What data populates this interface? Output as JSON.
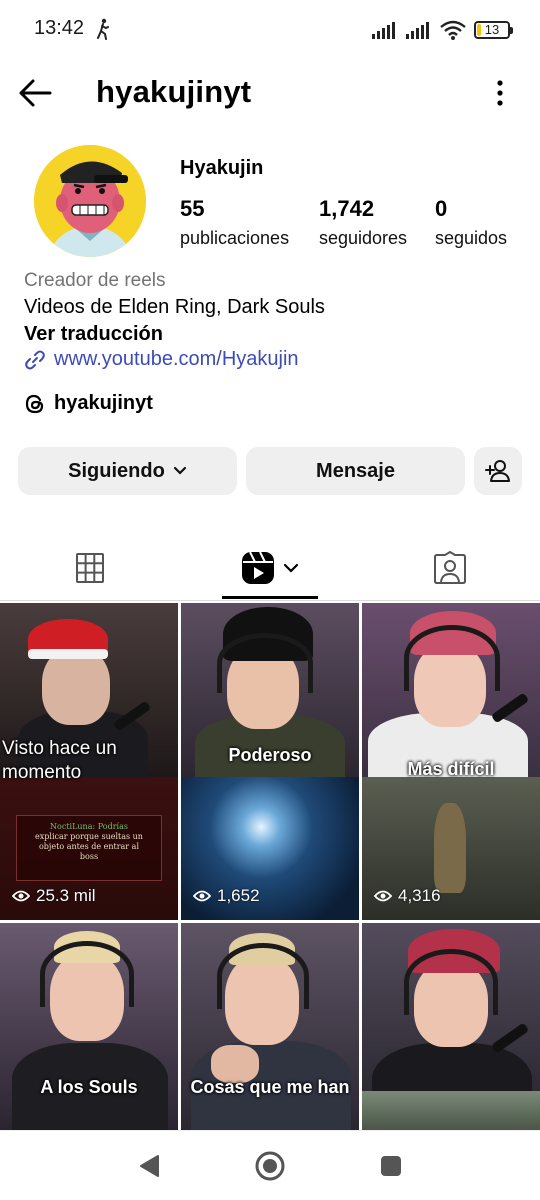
{
  "status_bar": {
    "time": "13:42",
    "battery": "13"
  },
  "header": {
    "username": "hyakujinyt"
  },
  "profile": {
    "display_name": "Hyakujin",
    "stats": [
      {
        "value": "55",
        "label": "publicaciones"
      },
      {
        "value": "1,742",
        "label": "seguidores"
      },
      {
        "value": "0",
        "label": "seguidos"
      }
    ],
    "category": "Creador de reels",
    "bio": "Videos de Elden Ring, Dark Souls",
    "translate": "Ver traducción",
    "link": "www.youtube.com/Hyakujin",
    "threads": "hyakujinyt"
  },
  "actions": {
    "following": "Siguiendo",
    "message": "Mensaje"
  },
  "tabs": {
    "active": "reels"
  },
  "reels": [
    {
      "caption": "Visto hace un momento",
      "views": "25.3 mil",
      "overlay_line1": "NoctiLuna: Podrías",
      "overlay_line2": "explicar porque sueltas un",
      "overlay_line3": "objeto antes de entrar al",
      "overlay_line4": "boss"
    },
    {
      "caption": "Poderoso",
      "views": "1,652"
    },
    {
      "caption": "Más difícil",
      "views": "4,316"
    },
    {
      "caption": "A los Souls",
      "views": ""
    },
    {
      "caption": "Cosas que me han",
      "views": ""
    },
    {
      "caption": "",
      "views": ""
    }
  ]
}
